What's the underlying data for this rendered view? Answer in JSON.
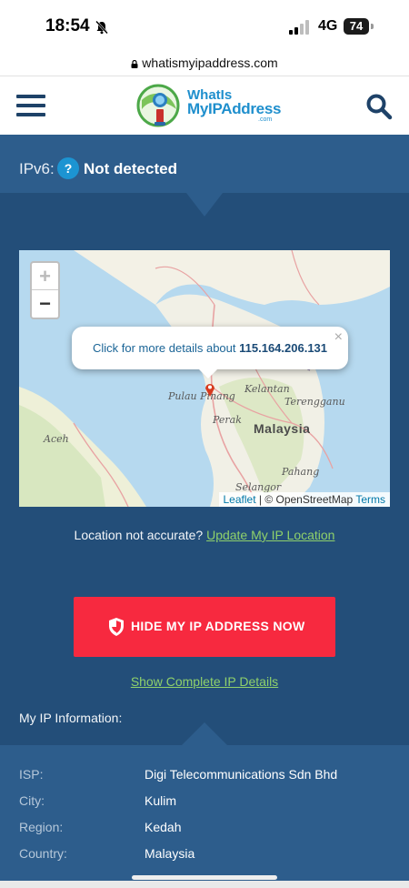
{
  "status_bar": {
    "time": "18:54",
    "network": "4G",
    "battery": "74"
  },
  "browser": {
    "url": "whatismyipaddress.com"
  },
  "header": {
    "logo_line1": "WhatIs",
    "logo_line2": "MyIPAddress",
    "logo_suffix": ".com"
  },
  "ipv6": {
    "label": "IPv6:",
    "help": "?",
    "value": "Not detected"
  },
  "map": {
    "zoom_in": "+",
    "zoom_out": "−",
    "popup_text": "Click for more details about",
    "popup_ip": "115.164.206.131",
    "popup_close": "×",
    "labels": {
      "pulau_pinang": "Pulau Pinang",
      "kelantan": "Kelantan",
      "terengganu": "Terengganu",
      "perak": "Perak",
      "aceh": "Aceh",
      "pahang": "Pahang",
      "selangor": "Selangor",
      "country": "Malaysia"
    },
    "attribution": {
      "leaflet": "Leaflet",
      "separator": " | © OpenStreetMap ",
      "terms": "Terms"
    }
  },
  "location": {
    "question": "Location not accurate?",
    "link": "Update My IP Location"
  },
  "hide_button": {
    "label": "HIDE MY IP ADDRESS NOW"
  },
  "details_link": "Show Complete IP Details",
  "ip_info": {
    "heading": "My IP Information:",
    "rows": [
      {
        "key": "ISP:",
        "value": "Digi Telecommunications Sdn Bhd"
      },
      {
        "key": "City:",
        "value": "Kulim"
      },
      {
        "key": "Region:",
        "value": "Kedah"
      },
      {
        "key": "Country:",
        "value": "Malaysia"
      }
    ]
  },
  "colors": {
    "header_blue": "#234e79",
    "panel_blue": "#2d5d8c",
    "accent_red": "#f7293f",
    "link_green": "#8fd16b"
  }
}
